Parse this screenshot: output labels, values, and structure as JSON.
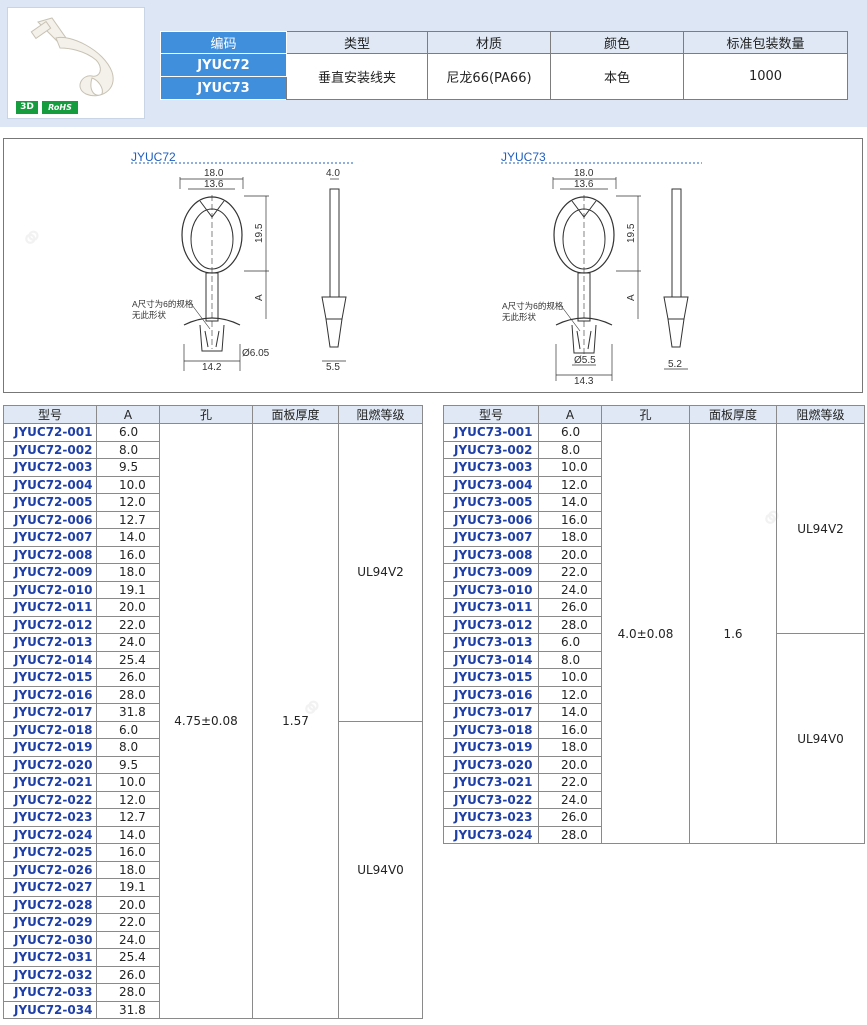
{
  "badges": {
    "three_d": "3D",
    "rohs": "RoHS"
  },
  "spec": {
    "headers": [
      "编码",
      "类型",
      "材质",
      "颜色",
      "标准包装数量"
    ],
    "codes": [
      "JYUC72",
      "JYUC73"
    ],
    "type": "垂直安装线夹",
    "material": "尼龙66(PA66)",
    "color": "本色",
    "package_qty": "1000"
  },
  "drawing": {
    "left": {
      "title": "JYUC72",
      "dim_outer": "18.0",
      "dim_inner": "13.6",
      "dim_height": "19.5",
      "dim_a": "A",
      "dim_side": "4.0",
      "note1": "A尺寸为6的规格",
      "note2": "无此形状",
      "dim_hole": "Ø6.05",
      "dim_base": "14.2",
      "dim_side_base": "5.5"
    },
    "right": {
      "title": "JYUC73",
      "dim_outer": "18.0",
      "dim_inner": "13.6",
      "dim_height": "19.5",
      "dim_a": "A",
      "note1": "A尺寸为6的规格",
      "note2": "无此形状",
      "dim_hole": "Ø5.5",
      "dim_base": "14.3",
      "dim_side_base": "5.2"
    }
  },
  "table_headers": [
    "型号",
    "A",
    "孔",
    "面板厚度",
    "阻燃等级"
  ],
  "left_table": {
    "hole": "4.75±0.08",
    "thickness": "1.57",
    "grade_v2": "UL94V2",
    "grade_v0": "UL94V0",
    "rows": [
      [
        "JYUC72-001",
        "6.0"
      ],
      [
        "JYUC72-002",
        "8.0"
      ],
      [
        "JYUC72-003",
        "9.5"
      ],
      [
        "JYUC72-004",
        "10.0"
      ],
      [
        "JYUC72-005",
        "12.0"
      ],
      [
        "JYUC72-006",
        "12.7"
      ],
      [
        "JYUC72-007",
        "14.0"
      ],
      [
        "JYUC72-008",
        "16.0"
      ],
      [
        "JYUC72-009",
        "18.0"
      ],
      [
        "JYUC72-010",
        "19.1"
      ],
      [
        "JYUC72-011",
        "20.0"
      ],
      [
        "JYUC72-012",
        "22.0"
      ],
      [
        "JYUC72-013",
        "24.0"
      ],
      [
        "JYUC72-014",
        "25.4"
      ],
      [
        "JYUC72-015",
        "26.0"
      ],
      [
        "JYUC72-016",
        "28.0"
      ],
      [
        "JYUC72-017",
        "31.8"
      ],
      [
        "JYUC72-018",
        "6.0"
      ],
      [
        "JYUC72-019",
        "8.0"
      ],
      [
        "JYUC72-020",
        "9.5"
      ],
      [
        "JYUC72-021",
        "10.0"
      ],
      [
        "JYUC72-022",
        "12.0"
      ],
      [
        "JYUC72-023",
        "12.7"
      ],
      [
        "JYUC72-024",
        "14.0"
      ],
      [
        "JYUC72-025",
        "16.0"
      ],
      [
        "JYUC72-026",
        "18.0"
      ],
      [
        "JYUC72-027",
        "19.1"
      ],
      [
        "JYUC72-028",
        "20.0"
      ],
      [
        "JYUC72-029",
        "22.0"
      ],
      [
        "JYUC72-030",
        "24.0"
      ],
      [
        "JYUC72-031",
        "25.4"
      ],
      [
        "JYUC72-032",
        "26.0"
      ],
      [
        "JYUC72-033",
        "28.0"
      ],
      [
        "JYUC72-034",
        "31.8"
      ]
    ]
  },
  "right_table": {
    "hole": "4.0±0.08",
    "thickness": "1.6",
    "grade_v2": "UL94V2",
    "grade_v0": "UL94V0",
    "rows": [
      [
        "JYUC73-001",
        "6.0"
      ],
      [
        "JYUC73-002",
        "8.0"
      ],
      [
        "JYUC73-003",
        "10.0"
      ],
      [
        "JYUC73-004",
        "12.0"
      ],
      [
        "JYUC73-005",
        "14.0"
      ],
      [
        "JYUC73-006",
        "16.0"
      ],
      [
        "JYUC73-007",
        "18.0"
      ],
      [
        "JYUC73-008",
        "20.0"
      ],
      [
        "JYUC73-009",
        "22.0"
      ],
      [
        "JYUC73-010",
        "24.0"
      ],
      [
        "JYUC73-011",
        "26.0"
      ],
      [
        "JYUC73-012",
        "28.0"
      ],
      [
        "JYUC73-013",
        "6.0"
      ],
      [
        "JYUC73-014",
        "8.0"
      ],
      [
        "JYUC73-015",
        "10.0"
      ],
      [
        "JYUC73-016",
        "12.0"
      ],
      [
        "JYUC73-017",
        "14.0"
      ],
      [
        "JYUC73-018",
        "16.0"
      ],
      [
        "JYUC73-019",
        "18.0"
      ],
      [
        "JYUC73-020",
        "20.0"
      ],
      [
        "JYUC73-021",
        "22.0"
      ],
      [
        "JYUC73-022",
        "24.0"
      ],
      [
        "JYUC73-023",
        "26.0"
      ],
      [
        "JYUC73-024",
        "28.0"
      ]
    ]
  },
  "colors": {
    "header_bg": "#dce6f4",
    "header_blue": "#3f8fdd",
    "model_text": "#1f3fa8",
    "badge_green": "#159c3e",
    "stripe": "#fbf1ec"
  }
}
